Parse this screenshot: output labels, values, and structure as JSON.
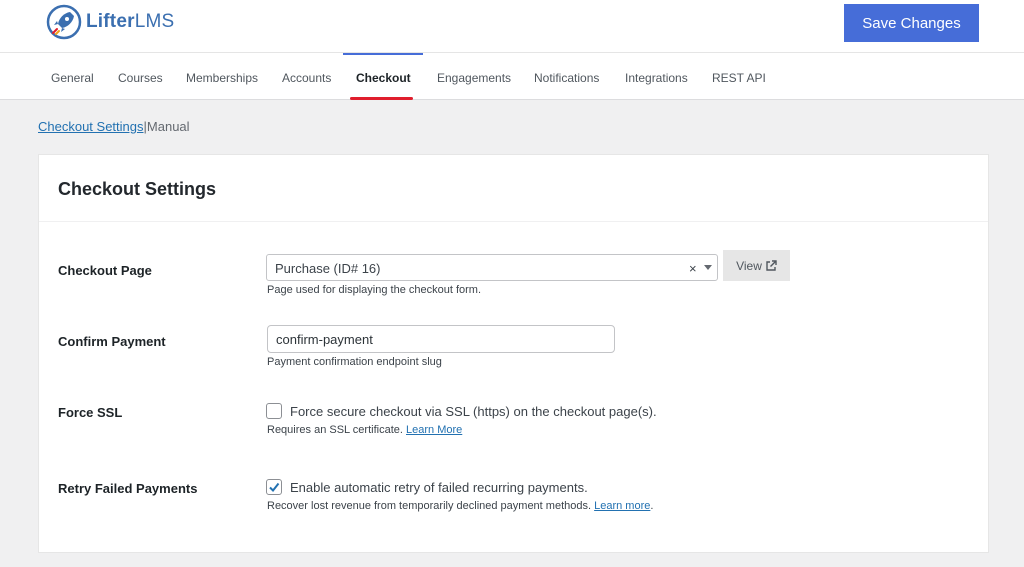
{
  "brand": {
    "name_part1": "Lifter",
    "name_part2": "LMS"
  },
  "header": {
    "save_label": "Save Changes"
  },
  "tabs": [
    {
      "label": "General",
      "active": false
    },
    {
      "label": "Courses",
      "active": false
    },
    {
      "label": "Memberships",
      "active": false
    },
    {
      "label": "Accounts",
      "active": false
    },
    {
      "label": "Checkout",
      "active": true
    },
    {
      "label": "Engagements",
      "active": false
    },
    {
      "label": "Notifications",
      "active": false
    },
    {
      "label": "Integrations",
      "active": false
    },
    {
      "label": "REST API",
      "active": false
    }
  ],
  "subnav": {
    "current": "Checkout Settings",
    "separator": "|",
    "other": "Manual"
  },
  "card": {
    "title": "Checkout Settings",
    "checkout_page": {
      "label": "Checkout Page",
      "selected": "Purchase (ID# 16)",
      "clear": "×",
      "view_label": "View",
      "description": "Page used for displaying the checkout form."
    },
    "confirm_payment": {
      "label": "Confirm Payment",
      "value": "confirm-payment",
      "description": "Payment confirmation endpoint slug"
    },
    "force_ssl": {
      "label": "Force SSL",
      "checked": false,
      "checkbox_label": "Force secure checkout via SSL (https) on the checkout page(s).",
      "description": "Requires an SSL certificate.",
      "link": "Learn More"
    },
    "retry_failed": {
      "label": "Retry Failed Payments",
      "checked": true,
      "checkbox_label": "Enable automatic retry of failed recurring payments.",
      "description": "Recover lost revenue from temporarily declined payment methods.",
      "link": "Learn more",
      "suffix": "."
    }
  },
  "colors": {
    "accent": "#466dd8",
    "active_tab_underline": "#e01e2d",
    "link": "#2271b1",
    "checkmark": "#2271b1"
  }
}
